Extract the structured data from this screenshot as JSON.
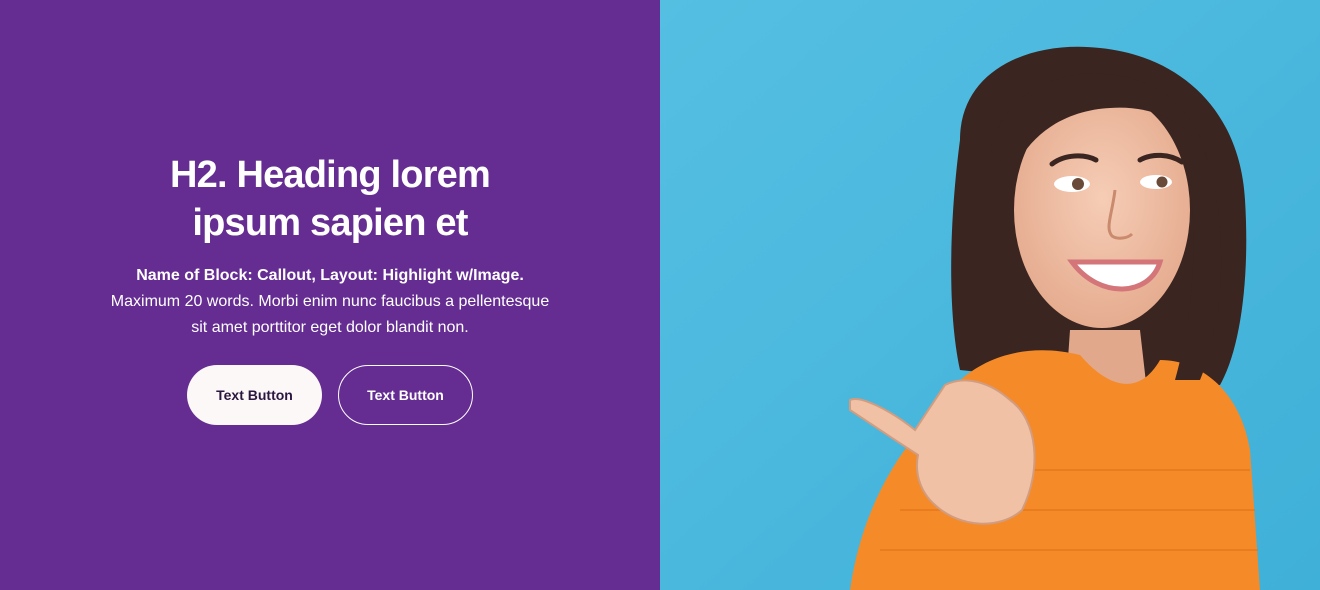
{
  "callout": {
    "heading": "H2. Heading lorem ipsum sapien et",
    "lead": "Name of Block: Callout, Layout: Highlight w/Image.",
    "body": "Maximum 20 words. Morbi enim nunc faucibus a pellentesque sit amet porttitor eget dolor blandit non.",
    "primary_button": "Text Button",
    "secondary_button": "Text Button"
  },
  "colors": {
    "panel_background": "#652d92",
    "image_background": "#4fb8dc",
    "primary_button_bg": "#fbf8f7",
    "sweater": "#f58a28"
  },
  "image": {
    "subject": "smiling woman in orange sweater pointing with thumb"
  }
}
